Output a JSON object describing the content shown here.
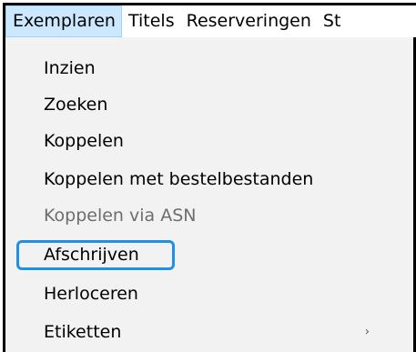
{
  "menubar": {
    "items": [
      {
        "label": "Exemplaren"
      },
      {
        "label": "Titels"
      },
      {
        "label": "Reserveringen"
      },
      {
        "label": "St"
      }
    ]
  },
  "dropdown": {
    "items": [
      {
        "label": "Inzien",
        "enabled": true
      },
      {
        "label": "Zoeken",
        "enabled": true
      },
      {
        "label": "Koppelen",
        "enabled": true
      },
      {
        "label": "Koppelen met bestelbestanden",
        "enabled": true
      },
      {
        "label": "Koppelen via ASN",
        "enabled": false
      },
      {
        "label": "Afschrijven",
        "enabled": true,
        "highlighted": true
      },
      {
        "label": "Herloceren",
        "enabled": true
      },
      {
        "label": "Etiketten",
        "enabled": true,
        "has_submenu": true,
        "submenu_glyph": "›"
      }
    ]
  },
  "colors": {
    "menu_background": "#f2f2f2",
    "active_menubar_bg": "#cce8ff",
    "highlight_border": "#1e90e6",
    "disabled_text": "#6d6d6d"
  }
}
